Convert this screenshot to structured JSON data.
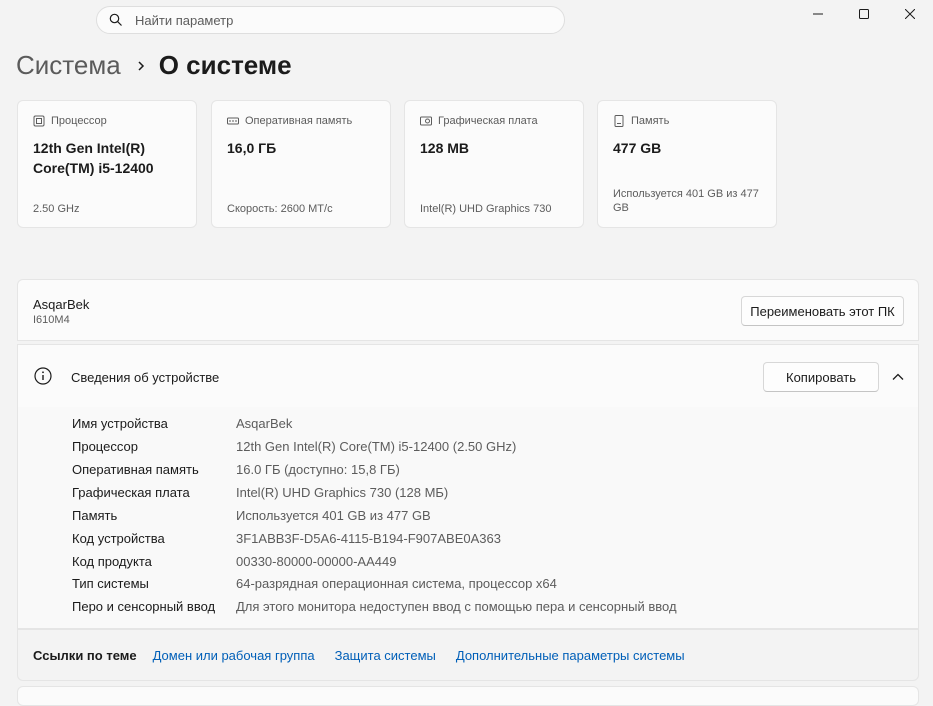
{
  "search": {
    "placeholder": "Найти параметр"
  },
  "breadcrumb": {
    "parent": "Система",
    "current": "О системе"
  },
  "cards": [
    {
      "caption": "Процессор",
      "value": "12th Gen Intel(R) Core(TM) i5-12400",
      "sub": "2.50 GHz",
      "icon": "cpu-icon"
    },
    {
      "caption": "Оперативная память",
      "value": "16,0 ГБ",
      "sub": "Скорость: 2600 MT/c",
      "icon": "ram-icon"
    },
    {
      "caption": "Графическая плата",
      "value": "128 MB",
      "sub": "Intel(R) UHD Graphics 730",
      "icon": "gpu-icon"
    },
    {
      "caption": "Память",
      "value": "477 GB",
      "sub": "Используется 401 GB из 477 GB",
      "icon": "storage-icon"
    }
  ],
  "pc": {
    "name": "AsqarBek",
    "model": "I610M4",
    "rename_label": "Переименовать этот ПК"
  },
  "device_info": {
    "title": "Сведения об устройстве",
    "copy_label": "Копировать",
    "rows": [
      {
        "key": "Имя устройства",
        "value": "AsqarBek"
      },
      {
        "key": "Процессор",
        "value": "12th Gen Intel(R) Core(TM) i5-12400 (2.50 GHz)"
      },
      {
        "key": "Оперативная память",
        "value": "16.0 ГБ (доступно: 15,8 ГБ)"
      },
      {
        "key": "Графическая плата",
        "value": "Intel(R) UHD Graphics 730 (128 МБ)"
      },
      {
        "key": "Память",
        "value": "Используется 401 GB из 477 GB"
      },
      {
        "key": "Код устройства",
        "value": "3F1ABB3F-D5A6-4115-B194-F907ABE0A363"
      },
      {
        "key": "Код продукта",
        "value": "00330-80000-00000-AA449"
      },
      {
        "key": "Тип системы",
        "value": "64-разрядная операционная система, процессор x64"
      },
      {
        "key": "Перо и сенсорный ввод",
        "value": "Для этого монитора недоступен ввод с помощью пера и сенсорный ввод"
      }
    ]
  },
  "related_links": {
    "label": "Ссылки по теме",
    "links": [
      "Домен или рабочая группа",
      "Защита системы",
      "Дополнительные параметры системы"
    ]
  },
  "colors": {
    "link": "#005fb8",
    "background": "#f3f3f3",
    "card": "#fbfbfb"
  }
}
